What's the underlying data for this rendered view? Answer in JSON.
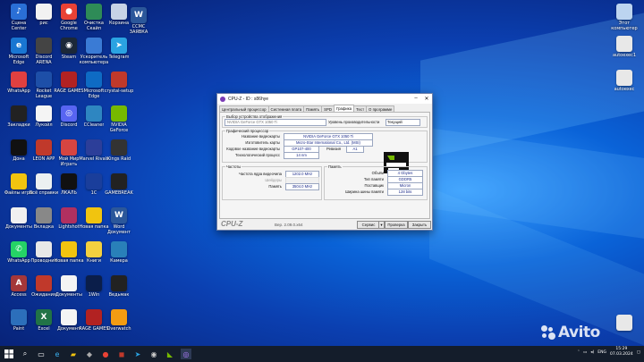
{
  "desktop": {
    "left_icons": [
      {
        "label": "Сцена Center",
        "color": "#2a6fd6",
        "glyph": "♪"
      },
      {
        "label": "рис",
        "color": "#f2f2f2",
        "glyph": ""
      },
      {
        "label": "Google Chrome",
        "color": "#e94235",
        "glyph": "●"
      },
      {
        "label": "Очистка Скайп ОКЕН-...",
        "color": "#2e8b57",
        "glyph": ""
      },
      {
        "label": "Корзина",
        "color": "#c7d3e6",
        "glyph": ""
      },
      {
        "label": "Microsoft Edge",
        "color": "#1976d2",
        "glyph": "e"
      },
      {
        "label": "Discord ARENA",
        "color": "#444",
        "glyph": ""
      },
      {
        "label": "Steam",
        "color": "#1b2838",
        "glyph": "◉"
      },
      {
        "label": "Ускоритель компьютера",
        "color": "#3a7bd5",
        "glyph": ""
      },
      {
        "label": "Telegram",
        "color": "#2aa3e2",
        "glyph": "➤"
      },
      {
        "label": "WhatsApp",
        "color": "#e04040",
        "glyph": ""
      },
      {
        "label": "Rocket League",
        "color": "#1d4fa8",
        "glyph": ""
      },
      {
        "label": "RAGE GAMES",
        "color": "#b22222",
        "glyph": ""
      },
      {
        "label": "Microsoft Edge",
        "color": "#0e6bc4",
        "glyph": ""
      },
      {
        "label": "crystal-setup",
        "color": "#c0392b",
        "glyph": ""
      },
      {
        "label": "Закладки",
        "color": "#222",
        "glyph": ""
      },
      {
        "label": "Лукойл",
        "color": "#f4f4f4",
        "glyph": ""
      },
      {
        "label": "Discord",
        "color": "#5865f2",
        "glyph": "◎"
      },
      {
        "label": "CCleaner",
        "color": "#2e86c1",
        "glyph": ""
      },
      {
        "label": "NVIDIA GeForce",
        "color": "#76b900",
        "glyph": ""
      },
      {
        "label": "Дона",
        "color": "#111",
        "glyph": ""
      },
      {
        "label": "LEON APP",
        "color": "#c0392b",
        "glyph": ""
      },
      {
        "label": "Мой Мир Играть",
        "color": "#d64541",
        "glyph": ""
      },
      {
        "label": "Marvel Rivals",
        "color": "#2c3e99",
        "glyph": ""
      },
      {
        "label": "Kings Raid",
        "color": "#333",
        "glyph": ""
      },
      {
        "label": "Файлы игры",
        "color": "#f1c40f",
        "glyph": ""
      },
      {
        "label": "Всё справки",
        "color": "#ecf0f1",
        "glyph": ""
      },
      {
        "label": "ЛКАЛЬ",
        "color": "#111",
        "glyph": ""
      },
      {
        "label": "1C",
        "color": "#1a3e9b",
        "glyph": ""
      },
      {
        "label": "GAMEBREAK",
        "color": "#222",
        "glyph": ""
      },
      {
        "label": "Документы",
        "color": "#f0f0f0",
        "glyph": ""
      },
      {
        "label": "Вкладка",
        "color": "#888",
        "glyph": ""
      },
      {
        "label": "Lightshot",
        "color": "#b03060",
        "glyph": ""
      },
      {
        "label": "Новая папка",
        "color": "#f1c40f",
        "glyph": ""
      },
      {
        "label": "Word Документ",
        "color": "#2b579a",
        "glyph": "W"
      },
      {
        "label": "WhatsApp",
        "color": "#25d366",
        "glyph": "✆"
      },
      {
        "label": "Проводник",
        "color": "#e8e8e8",
        "glyph": ""
      },
      {
        "label": "Новая папка",
        "color": "#f1c40f",
        "glyph": ""
      },
      {
        "label": "Книги",
        "color": "#f4d03f",
        "glyph": ""
      },
      {
        "label": "Камера",
        "color": "#2980b9",
        "glyph": ""
      },
      {
        "label": "Access",
        "color": "#a4373a",
        "glyph": "A"
      },
      {
        "label": "Ожидания",
        "color": "#c0392b",
        "glyph": ""
      },
      {
        "label": "Документы",
        "color": "#f4f4f4",
        "glyph": ""
      },
      {
        "label": "1Win",
        "color": "#0b1e4a",
        "glyph": ""
      },
      {
        "label": "Ведьмак",
        "color": "#222",
        "glyph": ""
      },
      {
        "label": "Paint",
        "color": "#2c6fbb",
        "glyph": ""
      },
      {
        "label": "Excel",
        "color": "#217346",
        "glyph": "X"
      },
      {
        "label": "Документ",
        "color": "#f4f4f4",
        "glyph": ""
      },
      {
        "label": "RAGE GAMES",
        "color": "#b22222",
        "glyph": ""
      },
      {
        "label": "Overwatch",
        "color": "#f39c12",
        "glyph": ""
      }
    ],
    "right_icons": [
      {
        "label": "Этот компьютер",
        "color": "#bcd4f0",
        "glyph": ""
      },
      {
        "label": "autoexec1",
        "color": "#e8e8e8",
        "glyph": ""
      },
      {
        "label": "autoexec",
        "color": "#e8e8e8",
        "glyph": ""
      },
      {
        "label": "",
        "color": "#e8e8e8",
        "glyph": ""
      }
    ],
    "top_doc": {
      "label": "ССМС ЗАЯВКА",
      "color": "#2b579a",
      "glyph": "W"
    }
  },
  "window": {
    "title": "CPU-Z - ID : s86hye",
    "tabs": [
      "Центральный процессор",
      "Системная плата",
      "Память",
      "SPD",
      "Графика",
      "Тест",
      "О программе"
    ],
    "active_tab": "Графика",
    "display_group": "Выбор устройства отображения",
    "device_select": "NVIDIA GeForce GTX 1050 Ti",
    "perf_label": "Уровень производительности",
    "perf_select": "Текущий",
    "gpu_group": "Графический процессор",
    "gpu_rows": [
      {
        "label": "Название видеокарты",
        "value": "NVIDIA GeForce GTX 1050 Ti"
      },
      {
        "label": "Изготовитель карты",
        "value": "Micro-Star International Co., Ltd. (MSI)"
      },
      {
        "label": "Кодовое название видеокарты",
        "value": "GP107-400"
      },
      {
        "label": "Технологический процесс",
        "value": "14 nm"
      }
    ],
    "revision_label": "Ревизия",
    "revision_value": "A1",
    "freq_group": "Частоты",
    "freq_rows": [
      {
        "label": "Частота ядра видеочипа",
        "value": "1202.0 MHz"
      },
      {
        "label": "Шейдеры",
        "value": ""
      },
      {
        "label": "Память",
        "value": "3504.0 MHz"
      }
    ],
    "mem_group": "Память",
    "mem_rows": [
      {
        "label": "Объём",
        "value": "4 Gbytes"
      },
      {
        "label": "Тип памяти",
        "value": "GDDR5"
      },
      {
        "label": "Поставщик",
        "value": "Micron"
      },
      {
        "label": "Ширина шины памяти",
        "value": "128 bits"
      }
    ],
    "brand": "CPU-Z",
    "version": "Вер. 2.09.0.x64",
    "service_btn": "Сервис",
    "check_btn": "Проверка",
    "close_btn": "Закрыть"
  },
  "taskbar": {
    "lang": "ENG",
    "time": "15:29",
    "date": "07.03.2024"
  },
  "watermark": "Avito"
}
